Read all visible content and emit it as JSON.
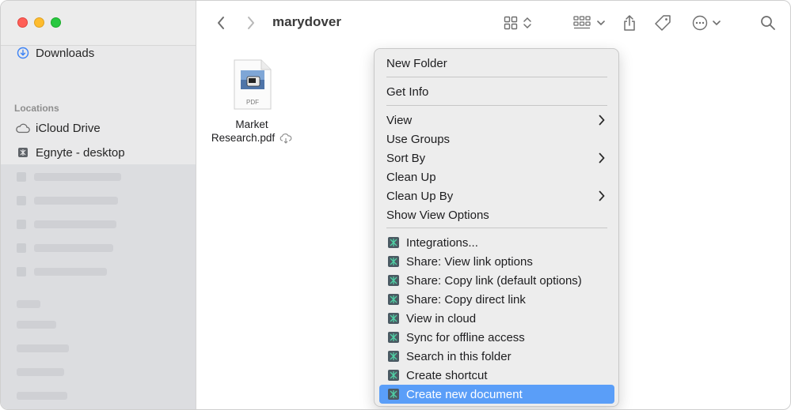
{
  "window": {
    "folder_title": "marydover"
  },
  "sidebar": {
    "favorites": [
      {
        "label": "Downloads",
        "icon": "download-icon"
      }
    ],
    "locations_header": "Locations",
    "locations": [
      {
        "label": "iCloud Drive",
        "icon": "cloud-icon"
      },
      {
        "label": "Egnyte - desktop",
        "icon": "drive-icon"
      }
    ]
  },
  "toolbar": {
    "back": "chevron-left-icon",
    "forward": "chevron-right-icon",
    "view": "grid-view-icon",
    "group": "group-icon",
    "share": "share-icon",
    "tags": "tag-icon",
    "more": "ellipsis-icon",
    "search": "search-icon"
  },
  "file": {
    "name_line1": "Market",
    "name_line2": "Research.pdf",
    "badge": "PDF"
  },
  "menu": {
    "new_folder": "New Folder",
    "get_info": "Get Info",
    "view": "View",
    "use_groups": "Use Groups",
    "sort_by": "Sort By",
    "clean_up": "Clean Up",
    "clean_up_by": "Clean Up By",
    "show_view_options": "Show View Options",
    "egnyte_items": [
      "Integrations...",
      "Share: View link options",
      "Share: Copy link (default options)",
      "Share: Copy direct link",
      "View in cloud",
      "Sync for offline access",
      "Search in this folder",
      "Create shortcut",
      "Create new document"
    ]
  },
  "colors": {
    "selection": "#5a9ef8",
    "sidebar": "#e9e9ea",
    "menu": "#ededed"
  }
}
